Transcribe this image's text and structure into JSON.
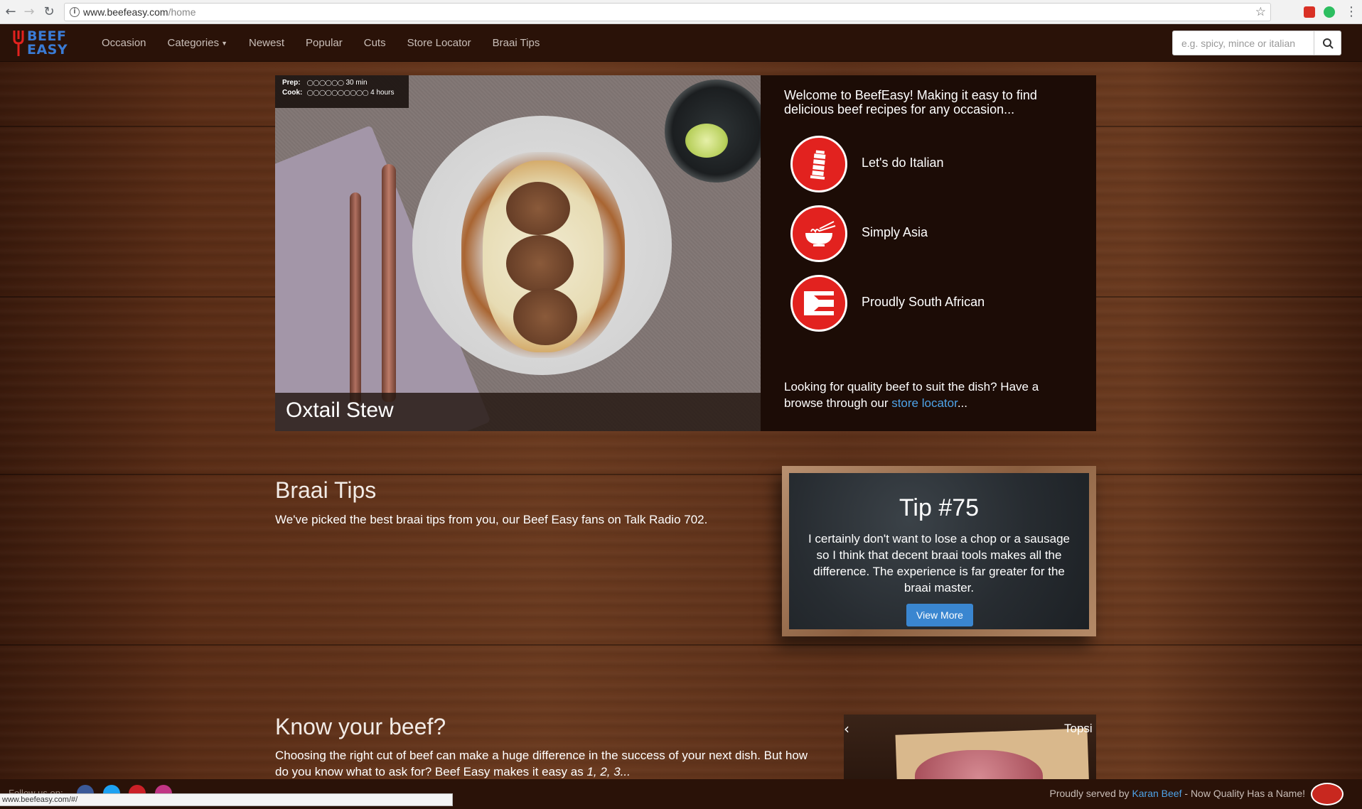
{
  "browser": {
    "url_domain": "www.beefeasy.com",
    "url_path": "/home",
    "status_url": "www.beefeasy.com/#/"
  },
  "navbar": {
    "logo_line1": "BEEF",
    "logo_line2": "EASY",
    "links": [
      "Occasion",
      "Categories",
      "Newest",
      "Popular",
      "Cuts",
      "Store Locator",
      "Braai Tips"
    ],
    "search_placeholder": "e.g. spicy, mince or italian"
  },
  "hero": {
    "prep_label": "Prep:",
    "prep_time": "30 min",
    "prep_rating": 6,
    "cook_label": "Cook:",
    "cook_time": "4 hours",
    "cook_rating": 10,
    "recipe_title": "Oxtail Stew",
    "welcome": "Welcome to BeefEasy! Making it easy to find delicious beef recipes for any occasion...",
    "occasions": [
      {
        "label": "Let's do Italian",
        "icon": "leaning-tower-icon"
      },
      {
        "label": "Simply Asia",
        "icon": "noodle-bowl-icon"
      },
      {
        "label": "Proudly South African",
        "icon": "sa-flag-icon"
      }
    ],
    "footer_text_before": "Looking for quality beef to suit the dish? Have a browse through our ",
    "footer_link": "store locator",
    "footer_text_after": "..."
  },
  "braai_tips": {
    "title": "Braai Tips",
    "text": "We've picked the best braai tips from you, our Beef Easy fans on Talk Radio 702.",
    "tip_title": "Tip #75",
    "tip_text": "I certainly don't want to lose a chop or a sausage so I think that decent braai tools makes all the difference. The experience is far greater for the braai master.",
    "tip_button": "View More"
  },
  "know_beef": {
    "title": "Know your beef?",
    "text_line": "Choosing the right cut of beef can make a huge difference in the success of your next dish. But how do you know what to ask for? Beef Easy makes it easy as ",
    "text_italic": "1, 2, 3...",
    "carousel_title": "Topsi"
  },
  "footer": {
    "follow": "Follow us on:",
    "served_before": "Proudly served by ",
    "served_link": "Karan Beef",
    "served_after": " - Now Quality Has a Name!"
  },
  "colors": {
    "accent_red": "#e2221f",
    "link_blue": "#4ea3e8",
    "button_blue": "#3a86d0",
    "navbar_bg": "#2a1208"
  }
}
